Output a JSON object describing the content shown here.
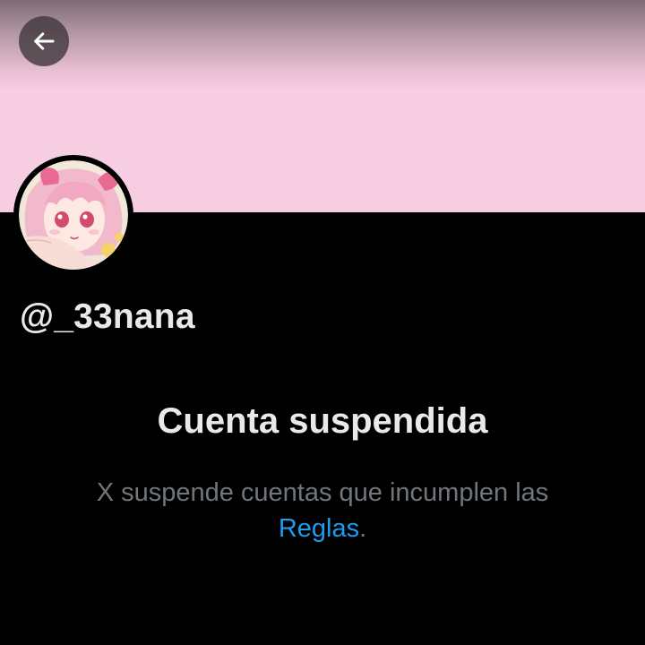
{
  "header": {
    "back_icon": "arrow-left-icon"
  },
  "colors": {
    "background": "#000000",
    "banner": "#f7cde1",
    "primary_text": "#e7e9ea",
    "secondary_text": "#71767b",
    "link": "#1d9bf0"
  },
  "profile": {
    "handle": "@_33nana",
    "avatar_icon": "anime-girl-avatar"
  },
  "suspension": {
    "title": "Cuenta suspendida",
    "message": "X suspende cuentas que incumplen las",
    "link_label": "Reglas",
    "trailing": "."
  }
}
